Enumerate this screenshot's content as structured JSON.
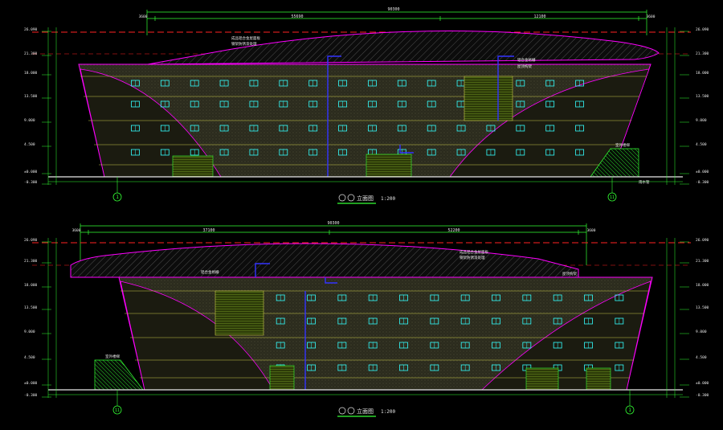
{
  "colors": {
    "background": "#000000",
    "dimension": "#33ff33",
    "facade_line": "#c8c84a",
    "roof_outline": "#ff00ff",
    "datum": "#ff2222",
    "window": "#33ffff",
    "pipe": "#3333ff",
    "text": "#e8e8e8"
  },
  "drawings": [
    {
      "id": "top",
      "overall_dim": "90300",
      "segment_dims": [
        "55690",
        "12100"
      ],
      "end_dims": [
        "3600",
        "3600"
      ],
      "elev_labels": [
        "26.090",
        "21.300",
        "18.000",
        "13.500",
        "9.000",
        "4.500",
        "±0.000",
        "-0.300"
      ],
      "axis_left": "1",
      "axis_right": "11",
      "stair_label": "室外楼梯",
      "stair_note": "雨水管",
      "roof_note_1": "成品铝合金屋面板",
      "roof_note_2": "钢架防锈漆处理",
      "annot_1": "铝合金格栅",
      "annot_2": "屋顶构架",
      "title": "立面图",
      "scale": "1:200"
    },
    {
      "id": "bottom",
      "overall_dim": "90300",
      "segment_dims": [
        "37100",
        "52200"
      ],
      "end_dims": [
        "3600",
        "3600"
      ],
      "elev_labels": [
        "26.090",
        "21.300",
        "18.000",
        "13.500",
        "9.000",
        "4.500",
        "±0.000",
        "-0.300"
      ],
      "axis_left": "11",
      "axis_right": "1",
      "stair_label": "室外楼梯",
      "roof_note_1": "成品铝合金屋面板",
      "roof_note_2": "钢架防锈漆处理",
      "annot_1": "铝合金格栅",
      "annot_2": "屋顶构架",
      "title": "立面图",
      "scale": "1:200"
    }
  ]
}
